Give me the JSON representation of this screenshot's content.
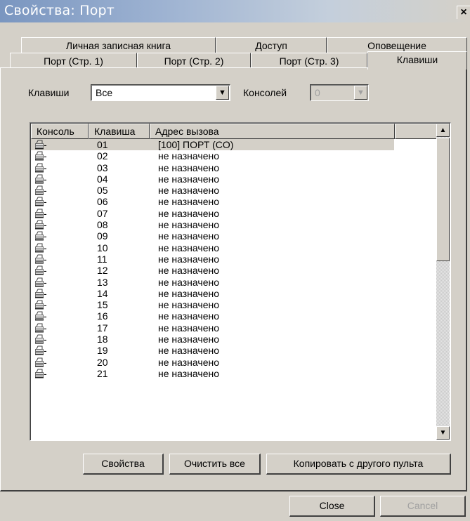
{
  "window": {
    "title": "Свойства: Порт",
    "close_glyph": "×"
  },
  "tabs_back": [
    "Личная записная книга",
    "Доступ",
    "Оповещение"
  ],
  "tabs_front": [
    "Порт (Стр. 1)",
    "Порт (Стр. 2)",
    "Порт (Стр. 3)",
    "Клавиши"
  ],
  "active_tab": "Клавиши",
  "filters": {
    "keys_label": "Клавиши",
    "keys_value": "Все",
    "consoles_label": "Консолей",
    "consoles_value": "0"
  },
  "table": {
    "columns": [
      "Консоль",
      "Клавиша",
      "Адрес вызова"
    ],
    "rows": [
      {
        "console": "-",
        "key": "01",
        "address": "[100] ПОРТ (CO)",
        "selected": true
      },
      {
        "console": "-",
        "key": "02",
        "address": "не назначено"
      },
      {
        "console": "-",
        "key": "03",
        "address": "не назначено"
      },
      {
        "console": "-",
        "key": "04",
        "address": "не назначено"
      },
      {
        "console": "-",
        "key": "05",
        "address": "не назначено"
      },
      {
        "console": "-",
        "key": "06",
        "address": "не назначено"
      },
      {
        "console": "-",
        "key": "07",
        "address": "не назначено"
      },
      {
        "console": "-",
        "key": "08",
        "address": "не назначено"
      },
      {
        "console": "-",
        "key": "09",
        "address": "не назначено"
      },
      {
        "console": "-",
        "key": "10",
        "address": "не назначено"
      },
      {
        "console": "-",
        "key": "11",
        "address": "не назначено"
      },
      {
        "console": "-",
        "key": "12",
        "address": "не назначено"
      },
      {
        "console": "-",
        "key": "13",
        "address": "не назначено"
      },
      {
        "console": "-",
        "key": "14",
        "address": "не назначено"
      },
      {
        "console": "-",
        "key": "15",
        "address": "не назначено"
      },
      {
        "console": "-",
        "key": "16",
        "address": "не назначено"
      },
      {
        "console": "-",
        "key": "17",
        "address": "не назначено"
      },
      {
        "console": "-",
        "key": "18",
        "address": "не назначено"
      },
      {
        "console": "-",
        "key": "19",
        "address": "не назначено"
      },
      {
        "console": "-",
        "key": "20",
        "address": "не назначено"
      },
      {
        "console": "-",
        "key": "21",
        "address": "не назначено"
      }
    ]
  },
  "buttons": {
    "properties": "Свойства",
    "clear_all": "Очистить все",
    "copy_from": "Копировать с другого пульта",
    "close": "Close",
    "cancel": "Cancel"
  },
  "icons": {
    "console_row": "console-keypad-icon",
    "scroll_up": "scroll-up-arrow-icon",
    "scroll_down": "scroll-down-arrow-icon",
    "dropdown": "dropdown-arrow-icon"
  }
}
